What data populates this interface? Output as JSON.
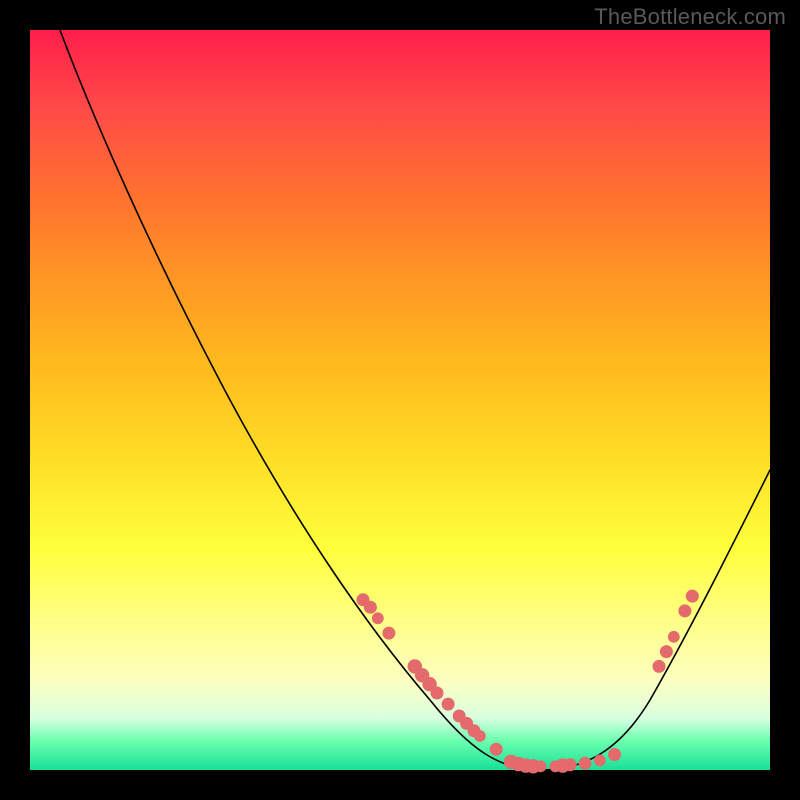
{
  "watermark": "TheBottleneck.com",
  "colors": {
    "dot": "#e46a6c",
    "curve": "#000000"
  },
  "chart_data": {
    "type": "line",
    "title": "",
    "xlabel": "",
    "ylabel": "",
    "xlim": [
      0,
      100
    ],
    "ylim": [
      0,
      100
    ],
    "grid": false,
    "legend": false,
    "description": "V-shaped bottleneck curve on a vertical red-to-green gradient. The y-axis (0 at bottom) represents how good the match is (green = good, red = bad); the x-axis is an unlabeled parameter sweep. Curve minimum is near x≈70.",
    "curve": [
      {
        "x": 4,
        "y": 100
      },
      {
        "x": 10,
        "y": 86
      },
      {
        "x": 20,
        "y": 66
      },
      {
        "x": 30,
        "y": 47
      },
      {
        "x": 40,
        "y": 30
      },
      {
        "x": 50,
        "y": 15
      },
      {
        "x": 58,
        "y": 6
      },
      {
        "x": 64,
        "y": 1
      },
      {
        "x": 70,
        "y": 0
      },
      {
        "x": 76,
        "y": 2
      },
      {
        "x": 82,
        "y": 8
      },
      {
        "x": 88,
        "y": 20
      },
      {
        "x": 94,
        "y": 32
      },
      {
        "x": 100,
        "y": 41
      }
    ],
    "highlight_points": [
      {
        "x": 45,
        "y": 23,
        "r": 1.0
      },
      {
        "x": 46,
        "y": 22,
        "r": 1.0
      },
      {
        "x": 47,
        "y": 20.5,
        "r": 0.9
      },
      {
        "x": 48.5,
        "y": 18.5,
        "r": 1.0
      },
      {
        "x": 52,
        "y": 14,
        "r": 1.1
      },
      {
        "x": 53,
        "y": 12.8,
        "r": 1.1
      },
      {
        "x": 54,
        "y": 11.6,
        "r": 1.1
      },
      {
        "x": 55,
        "y": 10.4,
        "r": 1.0
      },
      {
        "x": 56.5,
        "y": 8.9,
        "r": 1.0
      },
      {
        "x": 58,
        "y": 7.3,
        "r": 1.0
      },
      {
        "x": 59,
        "y": 6.3,
        "r": 1.0
      },
      {
        "x": 60,
        "y": 5.3,
        "r": 1.0
      },
      {
        "x": 60.8,
        "y": 4.6,
        "r": 0.9
      },
      {
        "x": 63,
        "y": 2.8,
        "r": 1.0
      },
      {
        "x": 65,
        "y": 1.1,
        "r": 1.1
      },
      {
        "x": 66,
        "y": 0.8,
        "r": 1.1
      },
      {
        "x": 67,
        "y": 0.6,
        "r": 1.1
      },
      {
        "x": 68,
        "y": 0.5,
        "r": 1.1
      },
      {
        "x": 69,
        "y": 0.5,
        "r": 0.9
      },
      {
        "x": 71,
        "y": 0.5,
        "r": 0.9
      },
      {
        "x": 72,
        "y": 0.6,
        "r": 1.1
      },
      {
        "x": 73,
        "y": 0.7,
        "r": 1.0
      },
      {
        "x": 75,
        "y": 0.9,
        "r": 1.0
      },
      {
        "x": 77,
        "y": 1.3,
        "r": 0.9
      },
      {
        "x": 79,
        "y": 2.1,
        "r": 1.0
      },
      {
        "x": 85,
        "y": 14,
        "r": 1.0
      },
      {
        "x": 86,
        "y": 16,
        "r": 1.0
      },
      {
        "x": 87,
        "y": 18,
        "r": 0.9
      },
      {
        "x": 88.5,
        "y": 21.5,
        "r": 1.0
      },
      {
        "x": 89.5,
        "y": 23.5,
        "r": 1.0
      }
    ]
  }
}
